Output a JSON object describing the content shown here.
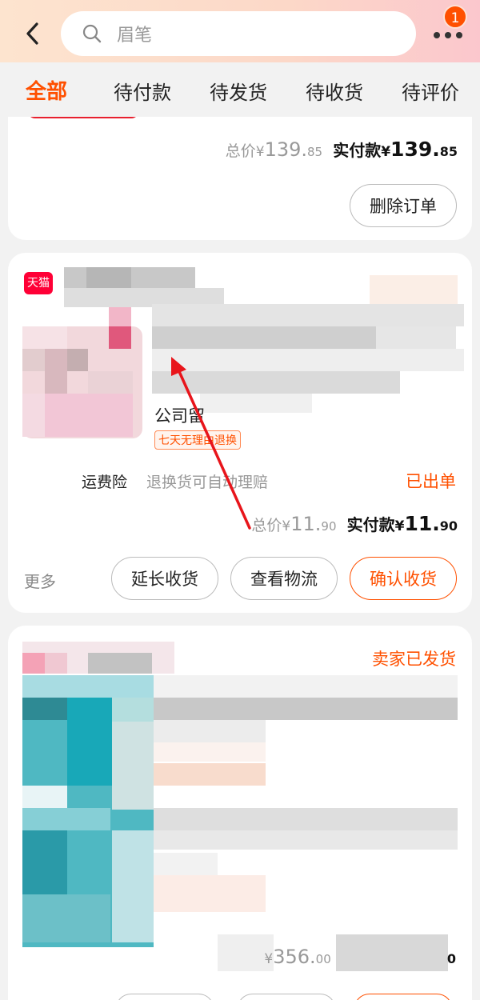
{
  "header": {
    "search_placeholder": "眉笔",
    "notification_count": "1",
    "icons": [
      "back-arrow-icon",
      "search-icon",
      "more-dots-icon"
    ]
  },
  "tabs": [
    {
      "label": "全部",
      "active": true
    },
    {
      "label": "待付款",
      "active": false
    },
    {
      "label": "待发货",
      "active": false
    },
    {
      "label": "待收货",
      "active": false
    },
    {
      "label": "待评价",
      "active": false
    }
  ],
  "orders": [
    {
      "total_label": "总价",
      "total_currency": "¥",
      "total_int": "139.",
      "total_dec": "85",
      "paid_label": "实付款",
      "paid_currency": "¥",
      "paid_int": "139.",
      "paid_dec": "85",
      "actions": [
        "删除订单"
      ]
    },
    {
      "store_badge": "天猫",
      "title_fragment": "公司留",
      "return_tag": "七天无理由退换",
      "insurance_label": "运费险",
      "insurance_desc": "退换货可自动理赔",
      "status": "已出单",
      "total_label": "总价",
      "total_currency": "¥",
      "total_int": "11.",
      "total_dec": "90",
      "paid_label": "实付款",
      "paid_currency": "¥",
      "paid_int": "11.",
      "paid_dec": "90",
      "more_label": "更多",
      "actions": [
        "延长收货",
        "查看物流",
        "确认收货"
      ]
    },
    {
      "status": "卖家已发货",
      "total_currency": "¥",
      "total_int": "356.",
      "total_dec": "00",
      "paid_dec": "0"
    }
  ],
  "colors": {
    "accent": "#ff5000",
    "tmall_red": "#ff0036",
    "background": "#f2f2f2"
  }
}
